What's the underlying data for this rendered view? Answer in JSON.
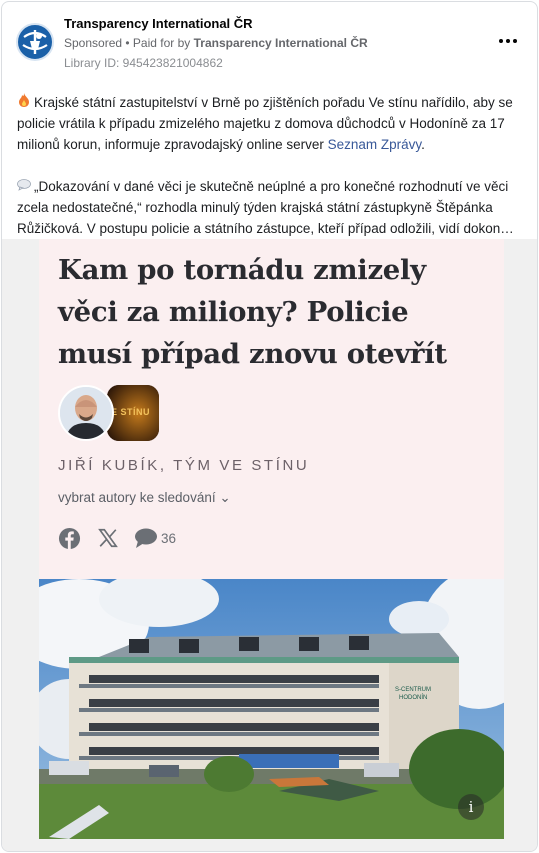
{
  "header": {
    "page_name": "Transparency International ČR",
    "sponsored": "Sponsored",
    "separator": " • ",
    "paid_for_prefix": "Paid for by ",
    "paid_for_name": "Transparency International ČR",
    "library_id": "Library ID: 945423821004862",
    "more_label": "•••"
  },
  "post": {
    "paragraph1_emoji": "flame",
    "paragraph1_text": "Krajské státní zastupitelství v Brně po zjištěních pořadu Ve stínu nařídilo, aby se policie vrátila k případu zmizelého majetku z domova důchodců v Hodoníně za 17 milionů korun, informuje zpravodajský online server ",
    "paragraph1_link": "Seznam Zprávy",
    "paragraph1_end": ".",
    "paragraph2_emoji": "speech-bubble",
    "paragraph2_text": "„Dokazování v dané věci je skutečně neúplné a pro konečné rozhodnutí ve věci zcela nedostatečné,“ rozhodla minulý týden krajská státní zástupkyně Štěpánka Růžičková. V postupu policie a státního zástupce, kteří případ odložili, vidí dokon…"
  },
  "article": {
    "headline": "Kam po tornádu zmizely věci za miliony? Policie musí případ znovu otevřít",
    "show_logo_text": "E STÍNU",
    "authors": "JIŘÍ KUBÍK, TÝM VE STÍNU",
    "follow_label": "vybrat autory ke sledování ⌄",
    "comment_count": "36",
    "building_sign": "S-CENTRUM HODONÍN",
    "info_label": "i"
  },
  "colors": {
    "link": "#385898",
    "article_bg": "#fbeff0",
    "brand_blue": "#1a60a8"
  }
}
